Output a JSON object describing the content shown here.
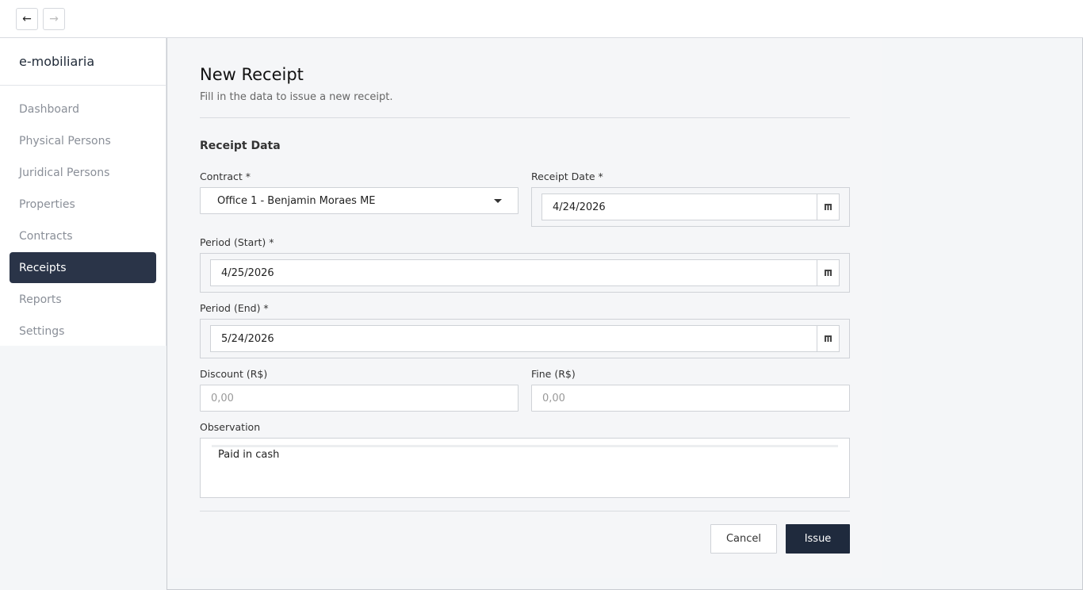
{
  "nav": {
    "back_glyph": "←",
    "forward_glyph": "→"
  },
  "sidebar": {
    "brand": "e-mobiliaria",
    "items": [
      {
        "label": "Dashboard",
        "active": false
      },
      {
        "label": "Physical Persons",
        "active": false
      },
      {
        "label": "Juridical Persons",
        "active": false
      },
      {
        "label": "Properties",
        "active": false
      },
      {
        "label": "Contracts",
        "active": false
      },
      {
        "label": "Receipts",
        "active": true
      },
      {
        "label": "Reports",
        "active": false
      },
      {
        "label": "Settings",
        "active": false
      }
    ]
  },
  "form": {
    "title": "New Receipt",
    "subtitle": "Fill in the data to issue a new receipt.",
    "section": "Receipt Data",
    "contract": {
      "label": "Contract *",
      "value": "Office 1 - Benjamin Moraes ME"
    },
    "receipt_date": {
      "label": "Receipt Date *",
      "value": "4/24/2026"
    },
    "period_start": {
      "label": "Period (Start) *",
      "value": "4/25/2026"
    },
    "period_end": {
      "label": "Period (End) *",
      "value": "5/24/2026"
    },
    "discount": {
      "label": "Discount (R$)",
      "placeholder": "0,00"
    },
    "fine": {
      "label": "Fine (R$)",
      "placeholder": "0,00"
    },
    "observation": {
      "label": "Observation",
      "value": "Paid in cash"
    },
    "cancel_label": "Cancel",
    "issue_label": "Issue"
  },
  "colors": {
    "active_nav": "#2a3448",
    "primary_button": "#1f2a3d"
  },
  "icons": [
    "arrow-left-icon",
    "arrow-right-icon",
    "dropdown-caret-icon",
    "calendar-icon"
  ]
}
